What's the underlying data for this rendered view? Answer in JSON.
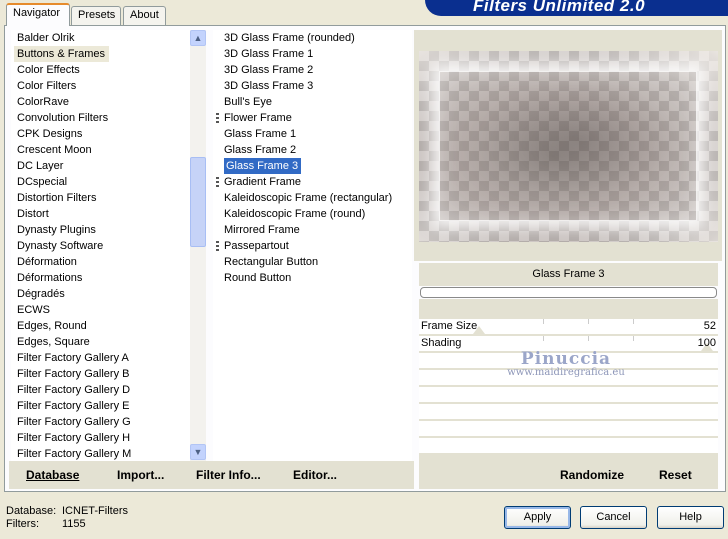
{
  "tabs": [
    "Navigator",
    "Presets",
    "About"
  ],
  "banner_title": "Filters Unlimited 2.0",
  "categories": [
    "Balder Olrik",
    "Buttons & Frames",
    "Color Effects",
    "Color Filters",
    "ColorRave",
    "Convolution Filters",
    "CPK Designs",
    "Crescent Moon",
    "DC Layer",
    "DCspecial",
    "Distortion Filters",
    "Distort",
    "Dynasty Plugins",
    "Dynasty Software",
    "Déformation",
    "Déformations",
    "Dégradés",
    "ECWS",
    "Edges, Round",
    "Edges, Square",
    "Filter Factory Gallery A",
    "Filter Factory Gallery B",
    "Filter Factory Gallery D",
    "Filter Factory Gallery E",
    "Filter Factory Gallery G",
    "Filter Factory Gallery H",
    "Filter Factory Gallery M"
  ],
  "filters": [
    "3D Glass Frame (rounded)",
    "3D Glass Frame 1",
    "3D Glass Frame 2",
    "3D Glass Frame 3",
    "Bull's Eye",
    "Flower Frame",
    "Glass Frame 1",
    "Glass Frame 2",
    "Glass Frame 3",
    "Gradient Frame",
    "Kaleidoscopic Frame (rectangular)",
    "Kaleidoscopic Frame (round)",
    "Mirrored Frame",
    "Passepartout",
    "Rectangular Button",
    "Round Button"
  ],
  "selected_filter": "Glass Frame 3",
  "parameters": [
    {
      "label": "Frame Size",
      "value": "52"
    },
    {
      "label": "Shading",
      "value": "100"
    }
  ],
  "watermark": {
    "name": "Pinuccia",
    "url": "www.maidiregrafica.eu"
  },
  "toolbar": {
    "database": "Database",
    "import": "Import...",
    "filter_info": "Filter Info...",
    "editor": "Editor...",
    "randomize": "Randomize",
    "reset": "Reset"
  },
  "footer": {
    "database_label": "Database:",
    "database_value": "ICNET-Filters",
    "filters_label": "Filters:",
    "filters_value": "1155"
  },
  "buttons": {
    "apply": "Apply",
    "cancel": "Cancel",
    "help": "Help"
  },
  "colors": {
    "selection": "#316AC5",
    "banner": "#0A2F8F",
    "dialog": "#ECE9D8"
  }
}
